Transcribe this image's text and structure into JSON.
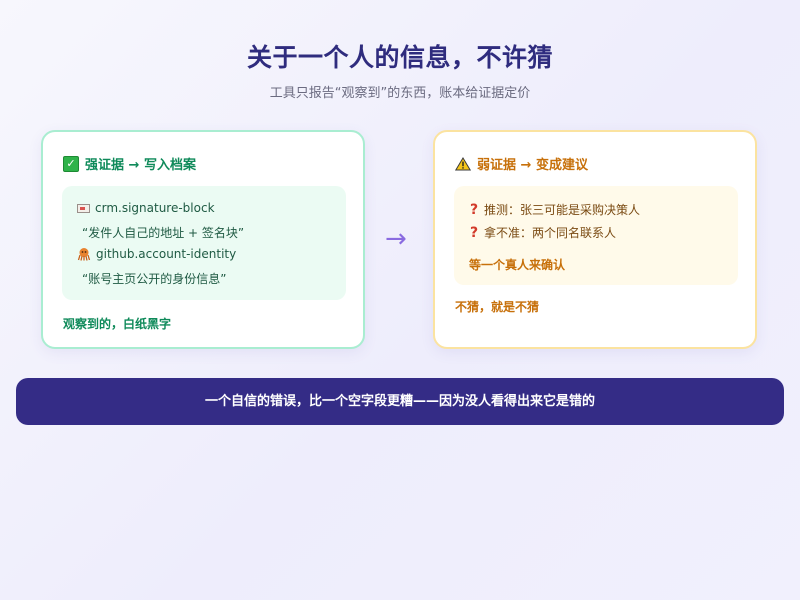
{
  "header": {
    "title": "关于一个人的信息，不许猜",
    "subtitle": "工具只报告“观察到”的东西，账本给证据定价"
  },
  "strong_card": {
    "heading": "强证据 → 写入档案",
    "icon": "check-mark-icon",
    "items": [
      {
        "icon": "email-icon",
        "source": "crm.signature-block",
        "quote": "“发件人自己的地址 + 签名块”"
      },
      {
        "icon": "octopus-icon",
        "source": "github.account-identity",
        "quote": "“账号主页公开的身份信息”"
      }
    ],
    "footer": "观察到的，白纸黑字",
    "accent": "#0f8a5a",
    "border": "#a9edd1"
  },
  "arrow": "→",
  "weak_card": {
    "heading": "弱证据 → 变成建议",
    "icon": "warning-icon",
    "items": [
      {
        "icon": "question-icon",
        "text": "推测：张三可能是采购决策人"
      },
      {
        "icon": "question-icon",
        "text": "拿不准：两个同名联系人"
      }
    ],
    "conclusion": "等一个真人来确认",
    "footer": "不猜，就是不猜",
    "accent": "#c7700a",
    "border": "#fbe3a0"
  },
  "banner": {
    "text": "一个自信的错误，比一个空字段更糟——因为没人看得出来它是错的",
    "background": "#342c86"
  }
}
